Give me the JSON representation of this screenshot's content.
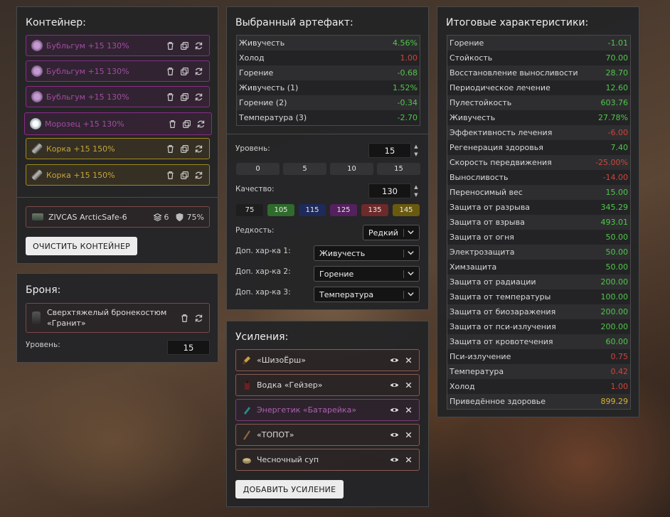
{
  "container": {
    "title": "Контейнер:",
    "slots": [
      {
        "label": "Бубльгум +15 130%",
        "color": "purple",
        "icon": "flower-artifact-icon"
      },
      {
        "label": "Бубльгум +15 130%",
        "color": "purple",
        "icon": "flower-artifact-icon"
      },
      {
        "label": "Бубльгум +15 130%",
        "color": "purple",
        "icon": "flower-artifact-icon"
      },
      {
        "label": "Морозец +15 130%",
        "color": "purple",
        "icon": "frost-artifact-icon"
      },
      {
        "label": "Корка +15 150%",
        "color": "yellow",
        "icon": "crust-artifact-icon"
      },
      {
        "label": "Корка +15 150%",
        "color": "yellow",
        "icon": "crust-artifact-icon"
      }
    ],
    "item": {
      "name": "ZIVCAS ArcticSafe-6",
      "slots": "6",
      "protection": "75%"
    },
    "clear_label": "ОЧИСТИТЬ КОНТЕЙНЕР"
  },
  "armor": {
    "title": "Броня:",
    "name": "Сверхтяжелый бронекостюм «Гранит»",
    "level_label": "Уровень:",
    "level": "15"
  },
  "artifact": {
    "title": "Выбранный артефакт:",
    "stats": [
      {
        "name": "Живучесть",
        "value": "4.56%",
        "tone": "pos"
      },
      {
        "name": "Холод",
        "value": "1.00",
        "tone": "neg"
      },
      {
        "name": "Горение",
        "value": "-0.68",
        "tone": "pos"
      },
      {
        "name": "Живучесть (1)",
        "value": "1.52%",
        "tone": "pos"
      },
      {
        "name": "Горение (2)",
        "value": "-0.34",
        "tone": "pos"
      },
      {
        "name": "Температура (3)",
        "value": "-2.70",
        "tone": "pos"
      }
    ],
    "level_label": "Уровень:",
    "level": "15",
    "level_presets": [
      "0",
      "5",
      "10",
      "15"
    ],
    "quality_label": "Качество:",
    "quality": "130",
    "quality_presets": [
      {
        "label": "75",
        "color": "#1e1e1e"
      },
      {
        "label": "105",
        "color": "#2f6b2c"
      },
      {
        "label": "115",
        "color": "#1e2a5a"
      },
      {
        "label": "125",
        "color": "#55205e"
      },
      {
        "label": "135",
        "color": "#6e2a2a"
      },
      {
        "label": "145",
        "color": "#6a5a10"
      }
    ],
    "rarity_label": "Редкость:",
    "rarity": "Редкий",
    "extra1_label": "Доп. хар-ка 1:",
    "extra1": "Живучесть",
    "extra2_label": "Доп. хар-ка 2:",
    "extra2": "Горение",
    "extra3_label": "Доп. хар-ка 3:",
    "extra3": "Температура"
  },
  "boosts": {
    "title": "Усиления:",
    "items": [
      {
        "label": "«ШизоЁрш»",
        "style": "normal",
        "icon": "brush-icon"
      },
      {
        "label": "Водка «Гейзер»",
        "style": "normal",
        "icon": "bottle-icon"
      },
      {
        "label": "Энергетик «Батарейка»",
        "style": "purple",
        "icon": "energy-drink-icon"
      },
      {
        "label": "«ТОПОТ»",
        "style": "normal",
        "icon": "stick-icon"
      },
      {
        "label": "Чесночный суп",
        "style": "normal",
        "icon": "soup-bowl-icon"
      }
    ],
    "add_label": "ДОБАВИТЬ УСИЛЕНИЕ"
  },
  "totals": {
    "title": "Итоговые характеристики:",
    "stats": [
      {
        "name": "Горение",
        "value": "-1.01",
        "tone": "pos"
      },
      {
        "name": "Стойкость",
        "value": "70.00",
        "tone": "pos"
      },
      {
        "name": "Восстановление выносливости",
        "value": "28.70",
        "tone": "pos"
      },
      {
        "name": "Периодическое лечение",
        "value": "12.60",
        "tone": "pos"
      },
      {
        "name": "Пулестойкость",
        "value": "603.76",
        "tone": "pos"
      },
      {
        "name": "Живучесть",
        "value": "27.78%",
        "tone": "pos"
      },
      {
        "name": "Эффективность лечения",
        "value": "-6.00",
        "tone": "neg"
      },
      {
        "name": "Регенерация здоровья",
        "value": "7.40",
        "tone": "pos"
      },
      {
        "name": "Скорость передвижения",
        "value": "-25.00%",
        "tone": "neg"
      },
      {
        "name": "Выносливость",
        "value": "-14.00",
        "tone": "neg"
      },
      {
        "name": "Переносимый вес",
        "value": "15.00",
        "tone": "pos"
      },
      {
        "name": "Защита от разрыва",
        "value": "345.29",
        "tone": "pos"
      },
      {
        "name": "Защита от взрыва",
        "value": "493.01",
        "tone": "pos"
      },
      {
        "name": "Защита от огня",
        "value": "50.00",
        "tone": "pos"
      },
      {
        "name": "Электрозащита",
        "value": "50.00",
        "tone": "pos"
      },
      {
        "name": "Химзащита",
        "value": "50.00",
        "tone": "pos"
      },
      {
        "name": "Защита от радиации",
        "value": "200.00",
        "tone": "pos"
      },
      {
        "name": "Защита от температуры",
        "value": "100.00",
        "tone": "pos"
      },
      {
        "name": "Защита от биозаражения",
        "value": "200.00",
        "tone": "pos"
      },
      {
        "name": "Защита от пси-излучения",
        "value": "200.00",
        "tone": "pos"
      },
      {
        "name": "Защита от кровотечения",
        "value": "60.00",
        "tone": "pos"
      },
      {
        "name": "Пси-излучение",
        "value": "0.75",
        "tone": "neg"
      },
      {
        "name": "Температура",
        "value": "0.42",
        "tone": "neg"
      },
      {
        "name": "Холод",
        "value": "1.00",
        "tone": "neg"
      },
      {
        "name": "Приведённое здоровье",
        "value": "899.29",
        "tone": "yel"
      }
    ]
  }
}
